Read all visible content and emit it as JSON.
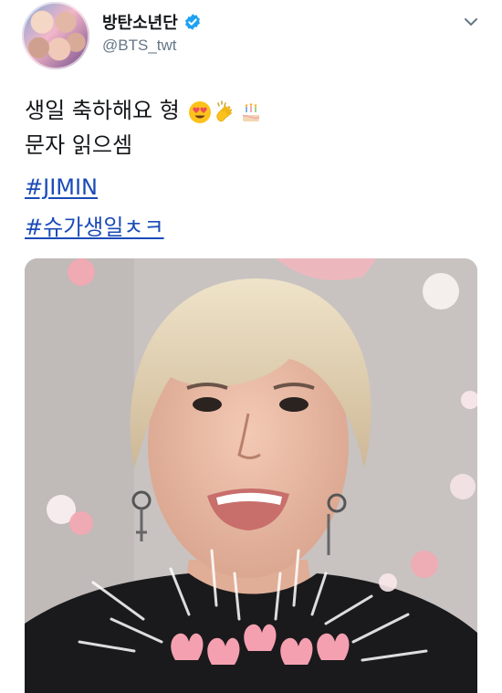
{
  "author": {
    "display_name": "방탄소년단",
    "handle": "@BTS_twt",
    "verified": true
  },
  "tweet": {
    "line1": "생일 축하해요 형",
    "line1_emojis": [
      "heart-eyes-emoji",
      "clapping-hands-emoji",
      "birthday-cake-emoji"
    ],
    "line2": "문자 읽으셈",
    "hashtags": [
      "#JIMIN",
      "#슈가생일ㅊㅋ"
    ]
  },
  "media": {
    "type": "video-thumbnail"
  },
  "colors": {
    "hashtag": "#1b4bb8",
    "verified": "#1da1f2",
    "handle": "#657786",
    "text": "#14171a"
  },
  "icons": {
    "menu": "chevron-down-icon",
    "verified": "verified-badge-icon"
  }
}
